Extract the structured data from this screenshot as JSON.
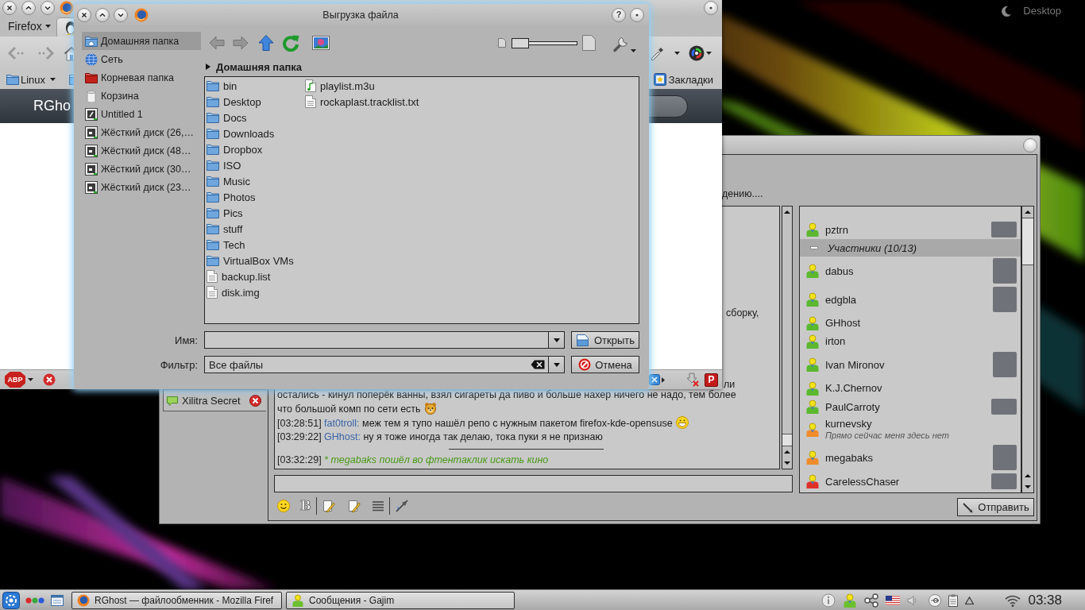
{
  "desktop": {
    "label": "Desktop"
  },
  "firefox": {
    "menu_button": "Firefox",
    "bookmark_folder": "Linux",
    "bookmarks_button": "Закладки",
    "page_heading": "RGho",
    "status_bar": {
      "adblock_label": "ABP",
      "addon_label": "P"
    }
  },
  "dialog": {
    "title": "Выгрузка файла",
    "help_button": "?",
    "places": [
      {
        "label": "Домашняя папка",
        "kind": "home",
        "selected": true
      },
      {
        "label": "Сеть",
        "kind": "network",
        "selected": false
      },
      {
        "label": "Корневая папка",
        "kind": "root",
        "selected": false
      },
      {
        "label": "Корзина",
        "kind": "trash",
        "selected": false
      },
      {
        "label": "Untitled 1",
        "kind": "volume",
        "selected": false
      },
      {
        "label": "Жёсткий диск (26,…",
        "kind": "disk",
        "selected": false
      },
      {
        "label": "Жёсткий диск (48…",
        "kind": "disk",
        "selected": false
      },
      {
        "label": "Жёсткий диск (30…",
        "kind": "disk",
        "selected": false
      },
      {
        "label": "Жёсткий диск (23…",
        "kind": "disk",
        "selected": false
      }
    ],
    "toolbar": [
      {
        "kind": "back",
        "disabled": true
      },
      {
        "kind": "forward",
        "disabled": true
      },
      {
        "kind": "up",
        "disabled": false
      },
      {
        "kind": "reload",
        "disabled": false
      },
      {
        "kind": "preview",
        "disabled": false
      }
    ],
    "zoom_slider": {
      "level": 0
    },
    "path": "Домашняя папка",
    "files": [
      {
        "name": "bin",
        "kind": "folder"
      },
      {
        "name": "Desktop",
        "kind": "folder"
      },
      {
        "name": "Docs",
        "kind": "folder"
      },
      {
        "name": "Downloads",
        "kind": "folder"
      },
      {
        "name": "Dropbox",
        "kind": "folder"
      },
      {
        "name": "ISO",
        "kind": "folder"
      },
      {
        "name": "Music",
        "kind": "folder"
      },
      {
        "name": "Photos",
        "kind": "folder"
      },
      {
        "name": "Pics",
        "kind": "folder"
      },
      {
        "name": "stuff",
        "kind": "folder"
      },
      {
        "name": "Tech",
        "kind": "folder"
      },
      {
        "name": "VirtualBox VMs",
        "kind": "folder"
      },
      {
        "name": "backup.list",
        "kind": "file"
      },
      {
        "name": "disk.img",
        "kind": "file"
      },
      {
        "name": "playlist.m3u",
        "kind": "audio"
      },
      {
        "name": "rockaplast.tracklist.txt",
        "kind": "text"
      }
    ],
    "name_label": "Имя:",
    "filter_label": "Фильтр:",
    "filter_value": "Все файлы",
    "open_button": "Открыть",
    "cancel_button": "Отмена"
  },
  "gajim": {
    "topic_fragment": "дению....",
    "tabs": [
      {
        "label": "Xilitra Secret",
        "selected": false
      }
    ],
    "chat": {
      "fragments": [
        "сборку,",
        "ли"
      ],
      "messages": [
        {
          "kind": "continuation",
          "lines": [
            "остались - кинул поперёк ванны, взял сигареты да пиво и больше нахер ничего не надо, тем более",
            "что большой комп по сети есть"
          ],
          "emoticon": {
            "kind": "bear"
          }
        },
        {
          "kind": "message",
          "time": "[03:28:51]",
          "nick": "fat0troll:",
          "text": "меж тем я тупо нашёл репо с нужным пакетом firefox-kde-opensuse",
          "emoticon": {
            "kind": "grin"
          }
        },
        {
          "kind": "message",
          "time": "[03:29:22]",
          "nick": "GHhost:",
          "text": "ну я тоже иногда так делаю, тока пуки я не признаю"
        },
        {
          "kind": "marker"
        },
        {
          "kind": "action",
          "time": "[03:32:29]",
          "text": "* megabaks пошёл во фтентаклик искать кино"
        }
      ]
    },
    "roster": [
      {
        "kind": "contact",
        "name": "pztrn",
        "color": "#5cb82e",
        "avatar": {
          "kind": "small"
        }
      },
      {
        "kind": "group",
        "label": "Участники (10/13)",
        "expanded": true
      },
      {
        "kind": "contact",
        "name": "dabus",
        "color": "#5cb82e",
        "avatar": {
          "kind": "large"
        }
      },
      {
        "kind": "contact",
        "name": "edgbla",
        "color": "#5cb82e",
        "avatar": {
          "kind": "large"
        }
      },
      {
        "kind": "contact",
        "name": "GHhost",
        "color": "#5cb82e"
      },
      {
        "kind": "contact",
        "name": "irton",
        "color": "#5cb82e"
      },
      {
        "kind": "contact",
        "name": "Ivan Mironov",
        "color": "#5cb82e",
        "avatar": {
          "kind": "large"
        }
      },
      {
        "kind": "contact",
        "name": "K.J.Chernov",
        "color": "#5cb82e"
      },
      {
        "kind": "contact",
        "name": "PaulCarroty",
        "color": "#5cb82e",
        "avatar": {
          "kind": "small"
        }
      },
      {
        "kind": "contact",
        "name": "kurnevsky",
        "status": "Прямо сейчас меня здесь нет",
        "color": "#f08c2a"
      },
      {
        "kind": "contact",
        "name": "megabaks",
        "color": "#f08c2a",
        "avatar": {
          "kind": "large"
        }
      },
      {
        "kind": "contact",
        "name": "CarelessChaser",
        "color": "#e0302a",
        "avatar": {
          "kind": "small"
        }
      }
    ],
    "bold_button": "B",
    "send_button": "Отправить"
  },
  "taskbar": {
    "tasks": [
      {
        "label": "RGhost — файлообменник - Mozilla Firef",
        "kind": "browser"
      },
      {
        "label": "Сообщения - Gajim",
        "kind": "chat"
      }
    ],
    "clock": "03:38"
  }
}
